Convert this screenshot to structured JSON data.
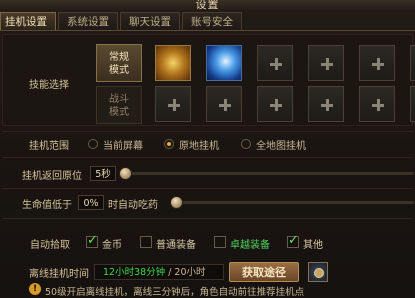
{
  "window": {
    "title": "设置"
  },
  "tabs": [
    {
      "label": "挂机设置",
      "active": true
    },
    {
      "label": "系统设置",
      "active": false
    },
    {
      "label": "聊天设置",
      "active": false
    },
    {
      "label": "账号安全",
      "active": false
    }
  ],
  "skills": {
    "label": "技能选择",
    "modes": [
      {
        "label": "常规模式",
        "active": true
      },
      {
        "label": "战斗模式",
        "active": false
      }
    ],
    "normal_slots": [
      "skill-gold-dragon-icon",
      "skill-blue-lightning-icon",
      "empty",
      "empty",
      "empty",
      "empty"
    ],
    "battle_slots": [
      "empty",
      "empty",
      "empty",
      "empty",
      "empty",
      "empty"
    ]
  },
  "range": {
    "label": "挂机范围",
    "options": [
      {
        "label": "当前屏幕",
        "selected": false
      },
      {
        "label": "原地挂机",
        "selected": true
      },
      {
        "label": "全地图挂机",
        "selected": false
      }
    ]
  },
  "return": {
    "label": "挂机返回原位",
    "value": "5秒",
    "level": 0.0
  },
  "hp": {
    "label_before": "生命值低于",
    "value": "0%",
    "label_after": "时自动吃药",
    "level": 0.0
  },
  "pickup": {
    "label": "自动拾取",
    "items": [
      {
        "label": "金币",
        "checked": true,
        "color": "#d8c9a6"
      },
      {
        "label": "普通装备",
        "checked": false,
        "color": "#d8c9a6"
      },
      {
        "label": "卓越装备",
        "checked": false,
        "color": "#4fd45a"
      },
      {
        "label": "其他",
        "checked": true,
        "color": "#d8c9a6"
      }
    ]
  },
  "offline": {
    "label": "离线挂机时间",
    "remaining": "12小时38分钟",
    "total": " / 20小时",
    "button": "获取途径"
  },
  "notice": {
    "text": "50级开启离线挂机，离线三分钟后，角色自动前往推荐挂机点"
  },
  "colors": {
    "accent": "#e8a54a",
    "green": "#43d84a",
    "panel": "#1b1612"
  }
}
